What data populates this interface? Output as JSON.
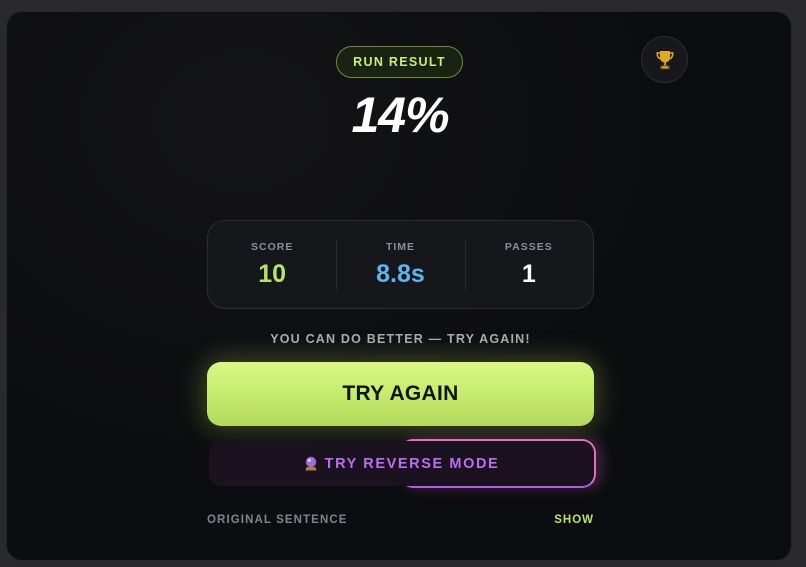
{
  "result": {
    "badge": "RUN RESULT",
    "percent": "14%"
  },
  "stats": [
    {
      "label": "SCORE",
      "value": "10"
    },
    {
      "label": "TIME",
      "value": "8.8s"
    },
    {
      "label": "PASSES",
      "value": "1"
    }
  ],
  "message": "YOU CAN DO BETTER — TRY AGAIN!",
  "actions": {
    "try_again": "TRY AGAIN",
    "reverse_mode": "TRY REVERSE MODE"
  },
  "footer": {
    "original_sentence": "ORIGINAL SENTENCE",
    "show": "SHOW"
  },
  "icons": {
    "trophy": "trophy-icon",
    "reverse": "crystal-ball-icon"
  },
  "colors": {
    "accent_green": "#c4ea6b",
    "time_blue": "#5cb5ee",
    "reverse_purple": "#bb6ff0",
    "reverse_pink": "#e86ac4"
  }
}
